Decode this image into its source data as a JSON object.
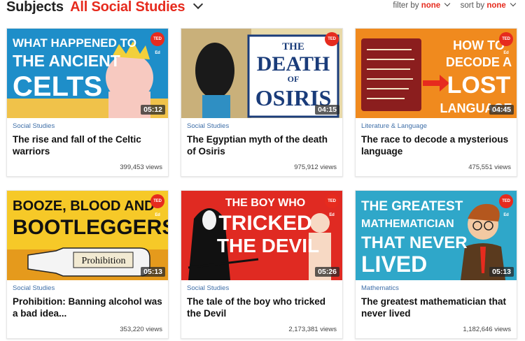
{
  "header": {
    "subjects_label": "Subjects",
    "selected_subject": "All Social Studies",
    "filter_label": "filter by",
    "filter_value": "none",
    "sort_label": "sort by",
    "sort_value": "none"
  },
  "colors": {
    "accent": "#e62b1e",
    "category": "#3f6fa8"
  },
  "cards": [
    {
      "thumb_text": [
        "WHAT HAPPENED TO",
        "THE ANCIENT",
        "CELTS"
      ],
      "badge": "TED Ed",
      "duration": "05:12",
      "category": "Social Studies",
      "title": "The rise and fall of the Celtic warriors",
      "views": "399,453 views"
    },
    {
      "thumb_text": [
        "THE",
        "DEATH",
        "OF",
        "OSIRIS"
      ],
      "badge": "TED Ed",
      "duration": "04:15",
      "category": "Social Studies",
      "title": "The Egyptian myth of the death of Osiris",
      "views": "975,912 views"
    },
    {
      "thumb_text": [
        "HOW TO",
        "DECODE A",
        "LOST",
        "LANGUAGE"
      ],
      "badge": "TED Ed",
      "duration": "04:45",
      "category": "Literature & Language",
      "title": "The race to decode a mysterious language",
      "views": "475,551 views"
    },
    {
      "thumb_text": [
        "BOOZE, BLOOD AND",
        "BOOTLEGGERS",
        "Prohibition"
      ],
      "badge": "TED Ed",
      "duration": "05:13",
      "category": "Social Studies",
      "title": "Prohibition: Banning alcohol was a bad idea...",
      "views": "353,220 views"
    },
    {
      "thumb_text": [
        "THE BOY WHO",
        "TRICKED",
        "THE DEVIL"
      ],
      "badge": "TED Ed",
      "duration": "05:26",
      "category": "Social Studies",
      "title": "The tale of the boy who tricked the Devil",
      "views": "2,173,381 views"
    },
    {
      "thumb_text": [
        "THE GREATEST",
        "MATHEMATICIAN",
        "THAT NEVER",
        "LIVED"
      ],
      "badge": "TED Ed",
      "duration": "05:13",
      "category": "Mathematics",
      "title": "The greatest mathematician that never lived",
      "views": "1,182,646 views"
    }
  ]
}
